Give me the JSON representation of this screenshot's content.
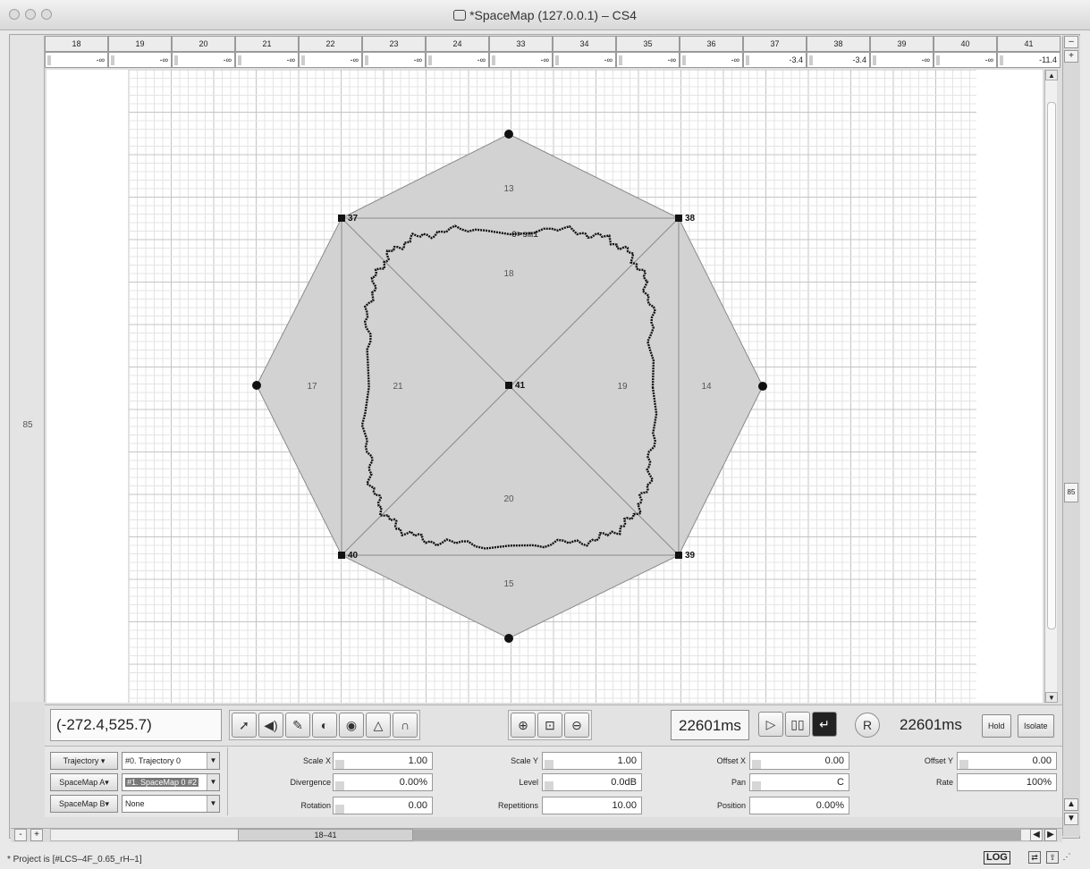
{
  "window": {
    "title": "*SpaceMap (127.0.0.1) – CS4"
  },
  "left_gutter": {
    "label": "85"
  },
  "right_strip": {
    "minus": "–",
    "plus": "+",
    "label": "85",
    "up": "▲",
    "down": "▼"
  },
  "speakers": {
    "ids": [
      "18",
      "19",
      "20",
      "21",
      "22",
      "23",
      "24",
      "33",
      "34",
      "35",
      "36",
      "37",
      "38",
      "39",
      "40",
      "41"
    ],
    "levels": [
      "-∞",
      "-∞",
      "-∞",
      "-∞",
      "-∞",
      "-∞",
      "-∞",
      "-∞",
      "-∞",
      "-∞",
      "-∞",
      "-3.4",
      "-3.4",
      "-∞",
      "-∞",
      "-11.4"
    ]
  },
  "canvas": {
    "points": [
      {
        "label": "37"
      },
      {
        "label": "38"
      },
      {
        "label": "39"
      },
      {
        "label": "40"
      },
      {
        "label": "41"
      }
    ],
    "regions": [
      "13",
      "14",
      "15",
      "17",
      "18",
      "19",
      "20",
      "21"
    ],
    "trajectory_label": "0>sm1"
  },
  "toolbar": {
    "coords": "(-272.4,525.7)",
    "time_start": "22601ms",
    "time_end": "22601ms",
    "hold": "Hold",
    "isolate": "Isolate"
  },
  "selectors": [
    {
      "button": "Trajectory ▾",
      "value": "#0. Trajectory 0"
    },
    {
      "button": "SpaceMap A▾",
      "value": "#1. SpaceMap 0 #2"
    },
    {
      "button": "SpaceMap B▾",
      "value": "None"
    }
  ],
  "params": {
    "scale_x": {
      "label": "Scale X",
      "value": "1.00"
    },
    "divergence": {
      "label": "Divergence",
      "value": "0.00%"
    },
    "rotation": {
      "label": "Rotation",
      "value": "0.00"
    },
    "scale_y": {
      "label": "Scale Y",
      "value": "1.00"
    },
    "level": {
      "label": "Level",
      "value": "0.0dB"
    },
    "repetitions": {
      "label": "Repetitions",
      "value": "10.00"
    },
    "offset_x": {
      "label": "Offset X",
      "value": "0.00"
    },
    "pan": {
      "label": "Pan",
      "value": "C"
    },
    "position": {
      "label": "Position",
      "value": "0.00%"
    },
    "offset_y": {
      "label": "Offset Y",
      "value": "0.00"
    },
    "rate": {
      "label": "Rate",
      "value": "100%"
    }
  },
  "hscroll": {
    "range": "18–41",
    "minus": "-",
    "plus": "+",
    "left": "◀",
    "right": "▶"
  },
  "status": {
    "text": "* Project is [#LCS–4F_0.65_rH–1]",
    "log": "LOG"
  }
}
